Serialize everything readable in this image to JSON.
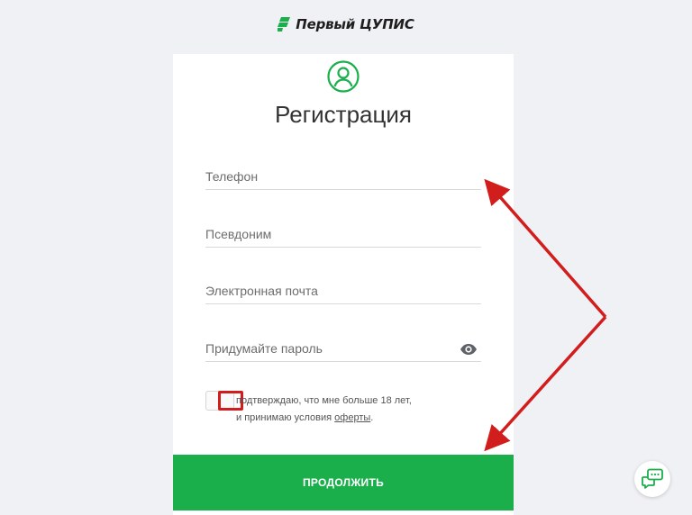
{
  "header": {
    "brand": "Первый ЦУПИС"
  },
  "form": {
    "title": "Регистрация",
    "phone_placeholder": "Телефон",
    "nickname_placeholder": "Псевдоним",
    "email_placeholder": "Электронная почта",
    "password_placeholder": "Придумайте пароль",
    "consent_line1": "подтверждаю, что мне больше 18 лет,",
    "consent_line2_prefix": "и принимаю условия",
    "consent_link": "оферты",
    "consent_line2_suffix": ".",
    "submit_label": "ПРОДОЛЖИТЬ"
  },
  "colors": {
    "accent": "#1aaf4b",
    "annotation": "#d21d1d",
    "background": "#f0f1f5"
  },
  "icons": {
    "brand": "cupis-logo-icon",
    "user": "user-circle-icon",
    "password_toggle": "eye-icon",
    "chat": "chat-bubble-icon"
  }
}
